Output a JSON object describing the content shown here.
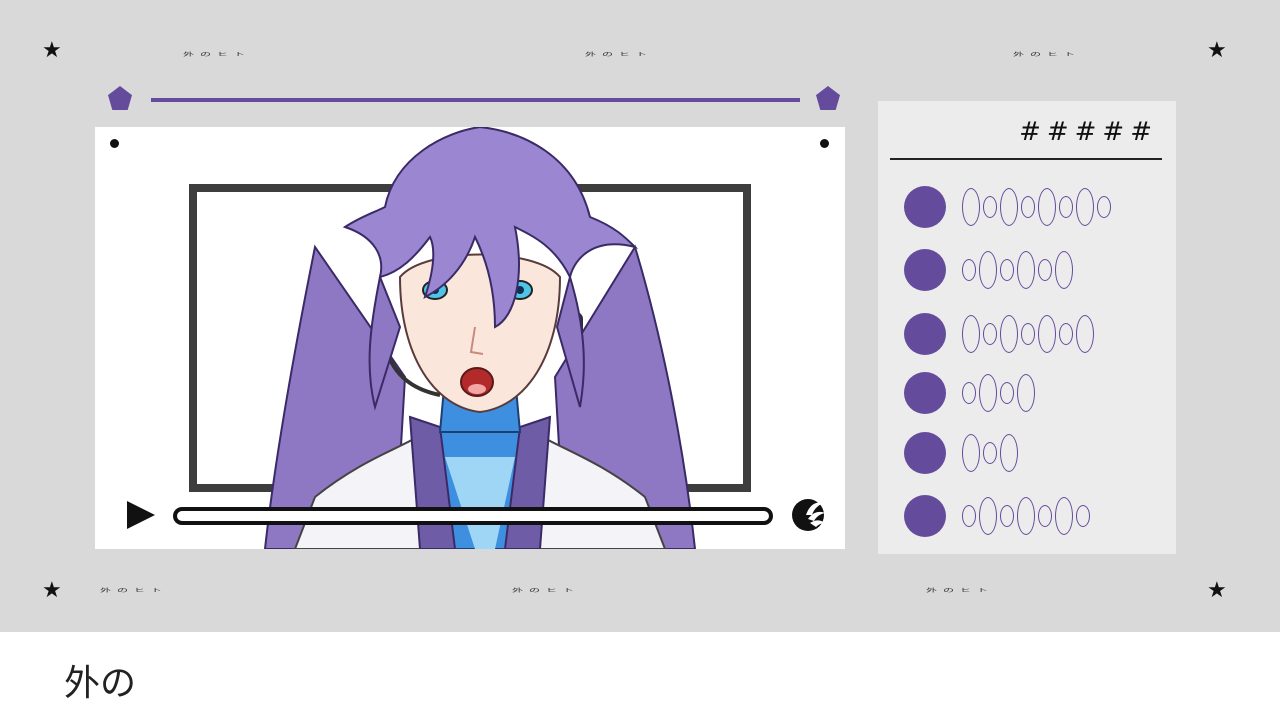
{
  "decorations": {
    "star_glyph": "★",
    "header_deco": [
      "外のヒト",
      "外のヒト",
      "外のヒト"
    ],
    "footer_deco": [
      "外のヒト",
      "外のヒト",
      "外のヒト"
    ]
  },
  "player": {
    "progress": 0
  },
  "panel": {
    "title": "#####",
    "items": [
      {
        "ovals": [
          2,
          1,
          2,
          1,
          2,
          1,
          2,
          1
        ]
      },
      {
        "ovals": [
          1,
          2,
          1,
          2,
          1,
          2
        ]
      },
      {
        "ovals": [
          2,
          1,
          2,
          1,
          2,
          1,
          2
        ]
      },
      {
        "ovals": [
          1,
          2,
          1,
          2
        ]
      },
      {
        "ovals": [
          2,
          1,
          2
        ]
      },
      {
        "ovals": [
          1,
          2,
          1,
          2,
          1,
          2,
          1
        ]
      }
    ]
  },
  "subtitle": {
    "text": "外の"
  },
  "colors": {
    "accent": "#654b9b",
    "background": "#d9d9d9",
    "panel": "#ececec"
  }
}
